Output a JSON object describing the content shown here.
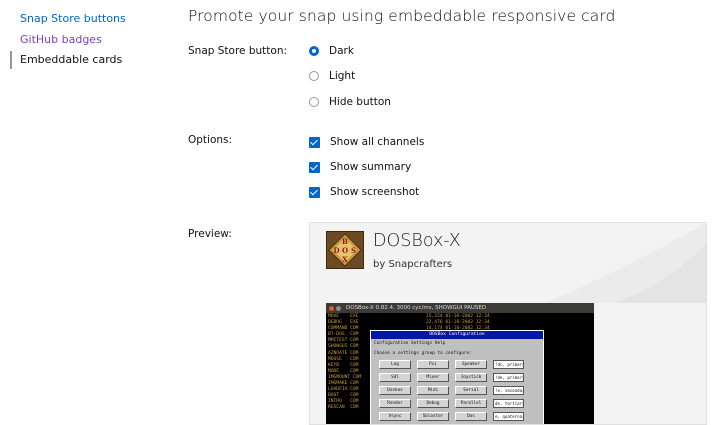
{
  "sidenav": {
    "items": [
      {
        "label": "Snap Store buttons"
      },
      {
        "label": "GitHub badges"
      },
      {
        "label": "Embeddable cards"
      }
    ]
  },
  "page": {
    "title": "Promote your snap using embeddable responsive card"
  },
  "form": {
    "store_button": {
      "label": "Snap Store button:",
      "options": [
        "Dark",
        "Light",
        "Hide button"
      ],
      "selected": "Dark"
    },
    "options": {
      "label": "Options:",
      "items": [
        {
          "label": "Show all channels",
          "checked": true
        },
        {
          "label": "Show summary",
          "checked": true
        },
        {
          "label": "Show screenshot",
          "checked": true
        }
      ]
    },
    "preview": {
      "label": "Preview:"
    }
  },
  "card": {
    "icon_text": "DOSBOX",
    "name": "DOSBox-X",
    "publisher": "by Snapcrafters",
    "screenshot": {
      "window_title": "DOSBox-X 0.82.4, 3000 cyc/ms, SHOWGUI PAUSED",
      "dos_names": "MOVE    EXE\nDEBUG   EXE\nCOMMAND COM\nBT-DOS  COM\nMMITEST COM\nSHOWGUI COM\nAZNOATE COM\nMOUSE   COM\nKEYB    COM\nMODE    COM\nIMGMOUNT COM\nIMGMAKE COM\nLOADFIX COM\nBOOT    COM\nINTRO   COM\nRESCAN  COM",
      "dos_details": "15,324 01-18-2002 12:34\n22,476 01-18-2002 12:34\n14,174 01-18-2002 12:34",
      "dialog_title": "DOSBox Configuration",
      "dialog_menu": "Configuration  Settings  Help",
      "dialog_prompt": "Choose a settings group to configure:",
      "buttons": [
        [
          "Log",
          "Pci",
          "Speaker"
        ],
        [
          "Sdl",
          "Mixer",
          "Joystick"
        ],
        [
          "Dosbox",
          "Midi",
          "Serial"
        ],
        [
          "Render",
          "Debug",
          "Parallel"
        ],
        [
          "Vsync",
          "Sblaster",
          "Dos"
        ]
      ],
      "side_boxes": [
        "!dc, primary",
        "!de, primary",
        "!e, secondary",
        "de, tertiary",
        "e, quaternary"
      ]
    }
  },
  "colors": {
    "accent": "#0066cc",
    "link_visited": "#7f3fbf",
    "card_bg": "#f3f3f3"
  }
}
